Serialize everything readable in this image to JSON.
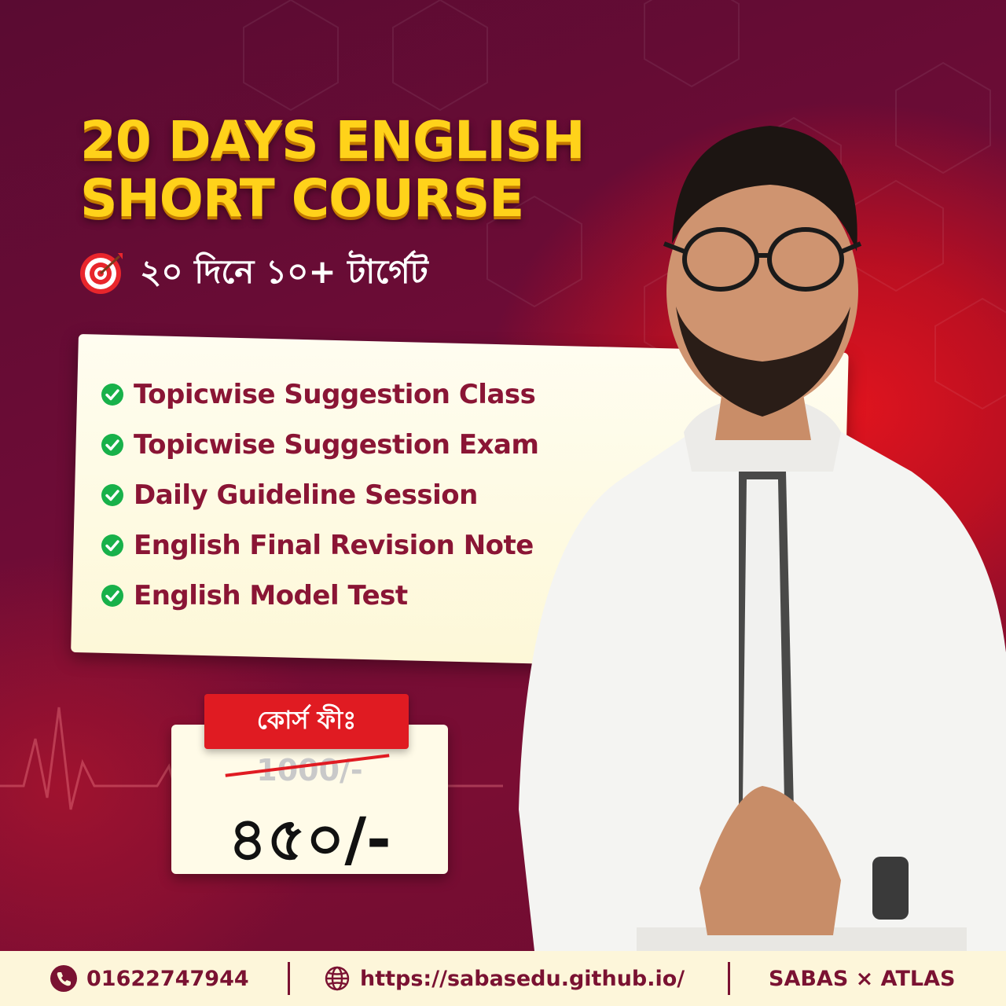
{
  "headline": {
    "line1": "20 DAYS ENGLISH",
    "line2": "SHORT COURSE"
  },
  "target": {
    "icon": "target-icon",
    "text": "২০ দিনে ১০+ টার্গেট"
  },
  "features": [
    "Topicwise Suggestion Class",
    "Topicwise Suggestion Exam",
    "Daily Guideline Session",
    "English Final Revision Note",
    "English Model Test"
  ],
  "pricing": {
    "label": "কোর্স ফীঃ",
    "old_price": "1000/-",
    "new_price": "৪৫০/-"
  },
  "footer": {
    "phone": "01622747944",
    "website": "https://sabasedu.github.io/",
    "brand": "SABAS × ATLAS"
  },
  "colors": {
    "accent_yellow": "#ffd21a",
    "feature_text": "#8a1535",
    "check_green": "#18b14a",
    "tag_red": "#e01b22",
    "footer_bg": "#fdf6da"
  }
}
